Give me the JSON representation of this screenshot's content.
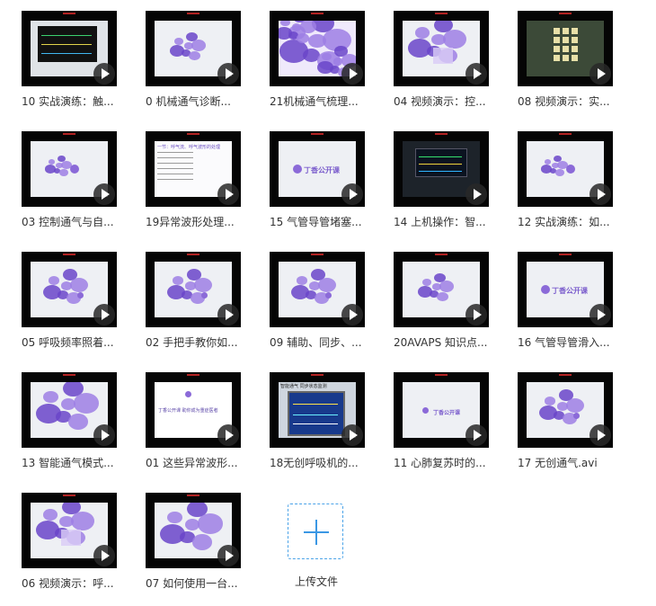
{
  "files": [
    {
      "name": "10 实战演练：触...",
      "art": "monitor"
    },
    {
      "name": "0 机械通气诊断...",
      "art": "flower-small"
    },
    {
      "name": "21机械通气梳理...",
      "art": "flower-full"
    },
    {
      "name": "04 视频演示：控...",
      "art": "flower-mosaic"
    },
    {
      "name": "08 视频演示：实...",
      "art": "device-panel"
    },
    {
      "name": "03 控制通气与自...",
      "art": "logo-flower"
    },
    {
      "name": "19异常波形处理...",
      "art": "slide-text"
    },
    {
      "name": "15 气管导管堵塞...",
      "art": "logo"
    },
    {
      "name": "14 上机操作：智...",
      "art": "monitor-dark"
    },
    {
      "name": "12 实战演练：如...",
      "art": "logo-flower"
    },
    {
      "name": "05 呼吸频率照着...",
      "art": "flower-medium"
    },
    {
      "name": "02 手把手教你如...",
      "art": "flower-medium"
    },
    {
      "name": "09 辅助、同步、...",
      "art": "flower-medium"
    },
    {
      "name": "20AVAPS 知识点...",
      "art": "flower-small"
    },
    {
      "name": "16 气管导管滑入...",
      "art": "logo"
    },
    {
      "name": "13 智能通气模式...",
      "art": "flower-large"
    },
    {
      "name": "01 这些异常波形...",
      "art": "slide-logo"
    },
    {
      "name": "18无创呼吸机的...",
      "art": "monitor-blue"
    },
    {
      "name": "11 心肺复苏时的...",
      "art": "logo-small"
    },
    {
      "name": "17 无创通气.avi",
      "art": "flower-medium"
    },
    {
      "name": "06 视频演示：呼...",
      "art": "flower-mosaic"
    },
    {
      "name": "07 如何使用一台...",
      "art": "flower-large"
    }
  ],
  "upload": {
    "label": "上传文件"
  },
  "logo_text": "丁香公开课",
  "slide_title": "一节：呼气流、呼气波形的处理",
  "slide_logo_text": "丁香公开课  助你成为重症医者",
  "monitor_title": "智能通气 同步状态监测",
  "colors": {
    "accent": "#3a97e4",
    "play": "#282828",
    "flower": "#7c5ad6"
  }
}
